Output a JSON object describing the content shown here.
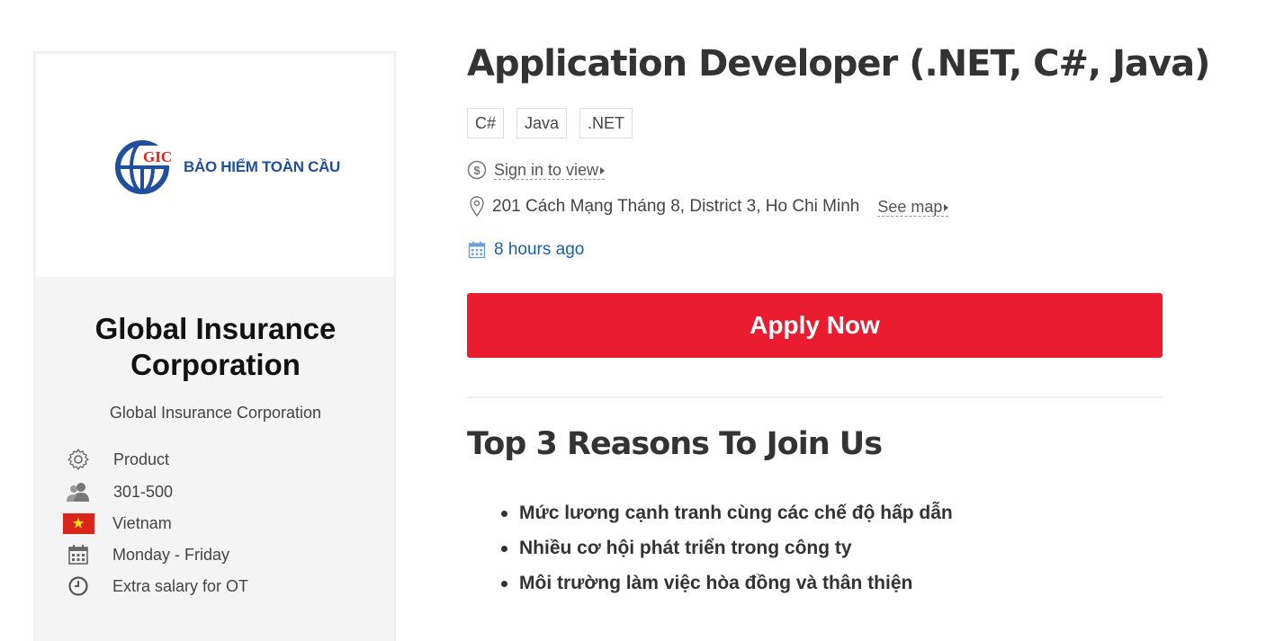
{
  "company": {
    "logo_text": "BẢO HIỂM TOÀN CẦU",
    "logo_mark": "GIC",
    "name": "Global Insurance Corporation",
    "subtitle": "Global Insurance Corporation",
    "info": {
      "type": "Product",
      "size": "301-500",
      "country": "Vietnam",
      "working_days": "Monday - Friday",
      "overtime": "Extra salary for OT"
    }
  },
  "job": {
    "title": "Application Developer (.NET, C#, Java)",
    "tags": [
      "C#",
      "Java",
      ".NET"
    ],
    "salary_link": "Sign in to view",
    "address": "201 Cách Mạng Tháng 8, District 3, Ho Chi Minh",
    "map_link": "See map",
    "posted": "8 hours ago",
    "apply_label": "Apply Now"
  },
  "reasons": {
    "title": "Top 3 Reasons To Join Us",
    "items": [
      "Mức lương cạnh tranh cùng các chế độ hấp dẫn",
      "Nhiều cơ hội phát triển trong công ty",
      "Môi trường làm việc hòa đồng và thân thiện"
    ]
  },
  "colors": {
    "accent": "#ea1c2f",
    "link_blue": "#1a5faa",
    "logo_blue": "#1f4f9d",
    "flag_red": "#da251d",
    "flag_star": "#ffde00"
  }
}
